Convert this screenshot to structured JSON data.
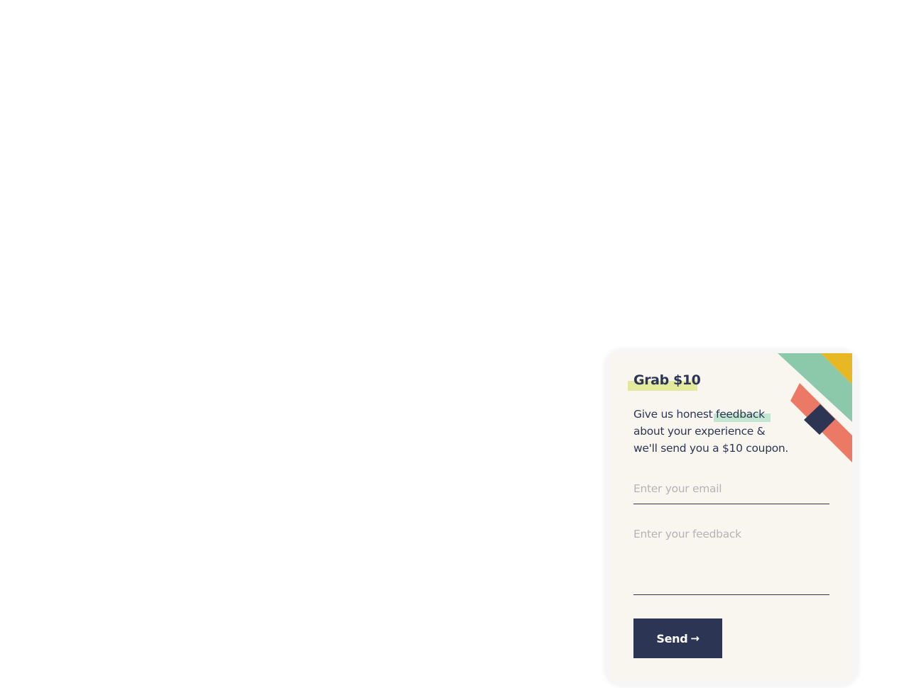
{
  "widget": {
    "title": "Grab $10",
    "description": {
      "line1_before": "Give us honest ",
      "line1_highlight": "feedback",
      "line2": "about your experience &",
      "line3": "we'll send you a $10 coupon."
    },
    "email_placeholder": "Enter your email",
    "email_value": "",
    "feedback_placeholder": "Enter your feedback",
    "feedback_value": "",
    "send_label": "Send",
    "send_arrow": "→",
    "collapse_icon": "chevron-down-icon"
  },
  "colors": {
    "panel_bg": "#f9f6ef",
    "navy": "#2c3654",
    "mint": "#8cc8aa",
    "coral": "#ec7866",
    "mustard": "#e8b824",
    "title_highlight": "#dfe88f",
    "word_highlight": "#c3e6d0",
    "placeholder": "#b4b4b4"
  }
}
